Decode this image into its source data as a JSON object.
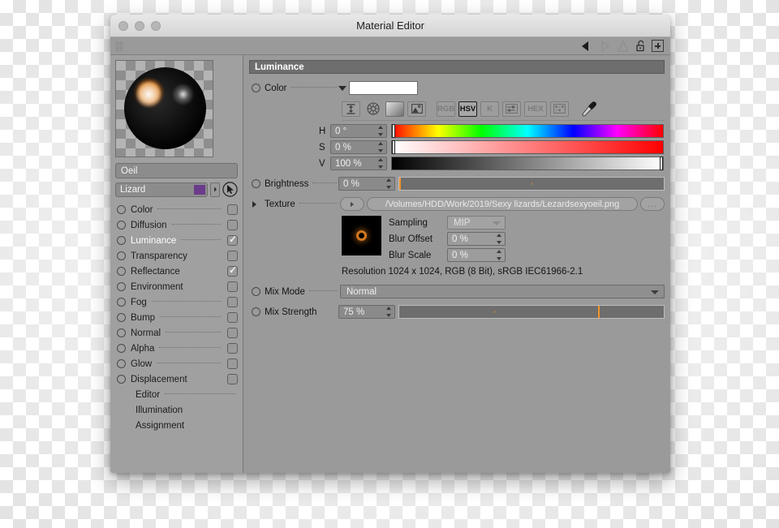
{
  "window": {
    "title": "Material Editor",
    "traffic_lights": [
      "close",
      "minimize",
      "zoom"
    ]
  },
  "toolbar": {
    "back_icon": "back-arrow-icon",
    "forward_icon": "forward-arrow-icon",
    "up_icon": "up-arrow-icon",
    "lock_icon": "unlocked-padlock-icon",
    "add_icon": "plus-box-icon"
  },
  "sidebar": {
    "material_name": "Oeil",
    "tag_name": "Lizard",
    "tag_color": "#6b3c8c",
    "channels": [
      {
        "label": "Color",
        "checked": false,
        "selected": false,
        "dotted": true
      },
      {
        "label": "Diffusion",
        "checked": false,
        "selected": false,
        "dotted": true
      },
      {
        "label": "Luminance",
        "checked": true,
        "selected": true,
        "dotted": true
      },
      {
        "label": "Transparency",
        "checked": false,
        "selected": false,
        "dotted": false
      },
      {
        "label": "Reflectance",
        "checked": true,
        "selected": false,
        "dotted": false
      },
      {
        "label": "Environment",
        "checked": false,
        "selected": false,
        "dotted": false
      },
      {
        "label": "Fog",
        "checked": false,
        "selected": false,
        "dotted": true
      },
      {
        "label": "Bump",
        "checked": false,
        "selected": false,
        "dotted": true
      },
      {
        "label": "Normal",
        "checked": false,
        "selected": false,
        "dotted": true
      },
      {
        "label": "Alpha",
        "checked": false,
        "selected": false,
        "dotted": true
      },
      {
        "label": "Glow",
        "checked": false,
        "selected": false,
        "dotted": true
      },
      {
        "label": "Displacement",
        "checked": false,
        "selected": false,
        "dotted": false
      }
    ],
    "pages": [
      {
        "label": "Editor",
        "dotted": true
      },
      {
        "label": "Illumination",
        "dotted": false
      },
      {
        "label": "Assignment",
        "dotted": false
      }
    ]
  },
  "panel": {
    "section_title": "Luminance",
    "color": {
      "label": "Color",
      "swatch_hex": "#ffffff",
      "modes": [
        "RGB",
        "HSV",
        "K",
        "HEX"
      ],
      "active_mode": "HSV",
      "mode_buttons": {
        "rgb": "RGB",
        "hsv": "HSV",
        "k": "K",
        "hex": "HEX"
      },
      "hsv": [
        {
          "letter": "H",
          "value": "0 °",
          "pos_pct": 0
        },
        {
          "letter": "S",
          "value": "0 %",
          "pos_pct": 0
        },
        {
          "letter": "V",
          "value": "100 %",
          "pos_pct": 100
        }
      ]
    },
    "brightness": {
      "label": "Brightness",
      "value": "0 %",
      "pos_pct": 0
    },
    "texture": {
      "label": "Texture",
      "path": "/Volumes/HDD/Work/2019/Sexy lizards/Lezardsexyoeil.png",
      "browse_label": "...",
      "sampling_label": "Sampling",
      "sampling_value": "MIP",
      "blur_offset_label": "Blur Offset",
      "blur_offset_value": "0 %",
      "blur_scale_label": "Blur Scale",
      "blur_scale_value": "0 %",
      "resolution_info": "Resolution 1024 x 1024, RGB (8 Bit), sRGB IEC61966-2.1"
    },
    "mix_mode": {
      "label": "Mix Mode",
      "value": "Normal"
    },
    "mix_strength": {
      "label": "Mix Strength",
      "value": "75 %",
      "pos_pct": 75
    }
  }
}
